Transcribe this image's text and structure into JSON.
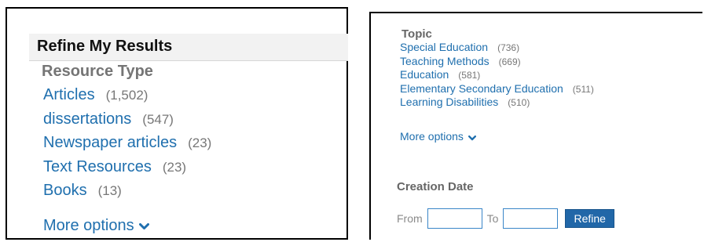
{
  "left_panel": {
    "title": "Refine My Results",
    "section_heading": "Resource Type",
    "items": [
      {
        "label": "Articles",
        "count": "(1,502)"
      },
      {
        "label": "dissertations",
        "count": "(547)"
      },
      {
        "label": "Newspaper articles",
        "count": "(23)"
      },
      {
        "label": "Text Resources",
        "count": "(23)"
      },
      {
        "label": "Books",
        "count": "(13)"
      }
    ],
    "more_options": "More options"
  },
  "right_panel": {
    "topic_heading": "Topic",
    "topics": [
      {
        "label": "Special Education",
        "count": "(736)"
      },
      {
        "label": "Teaching Methods",
        "count": "(669)"
      },
      {
        "label": "Education",
        "count": "(581)"
      },
      {
        "label": "Elementary Secondary Education",
        "count": "(511)"
      },
      {
        "label": "Learning Disabilities",
        "count": "(510)"
      }
    ],
    "more_options": "More options",
    "creation_date_heading": "Creation Date",
    "from_label": "From",
    "to_label": "To",
    "from_value": "",
    "to_value": "",
    "refine_button": "Refine"
  },
  "colors": {
    "link": "#1f6fae",
    "count": "#777777",
    "heading": "#757575",
    "button": "#2167a8",
    "input_border": "#3a86c8"
  },
  "icons": {
    "more_options": "chevron-down-icon"
  }
}
